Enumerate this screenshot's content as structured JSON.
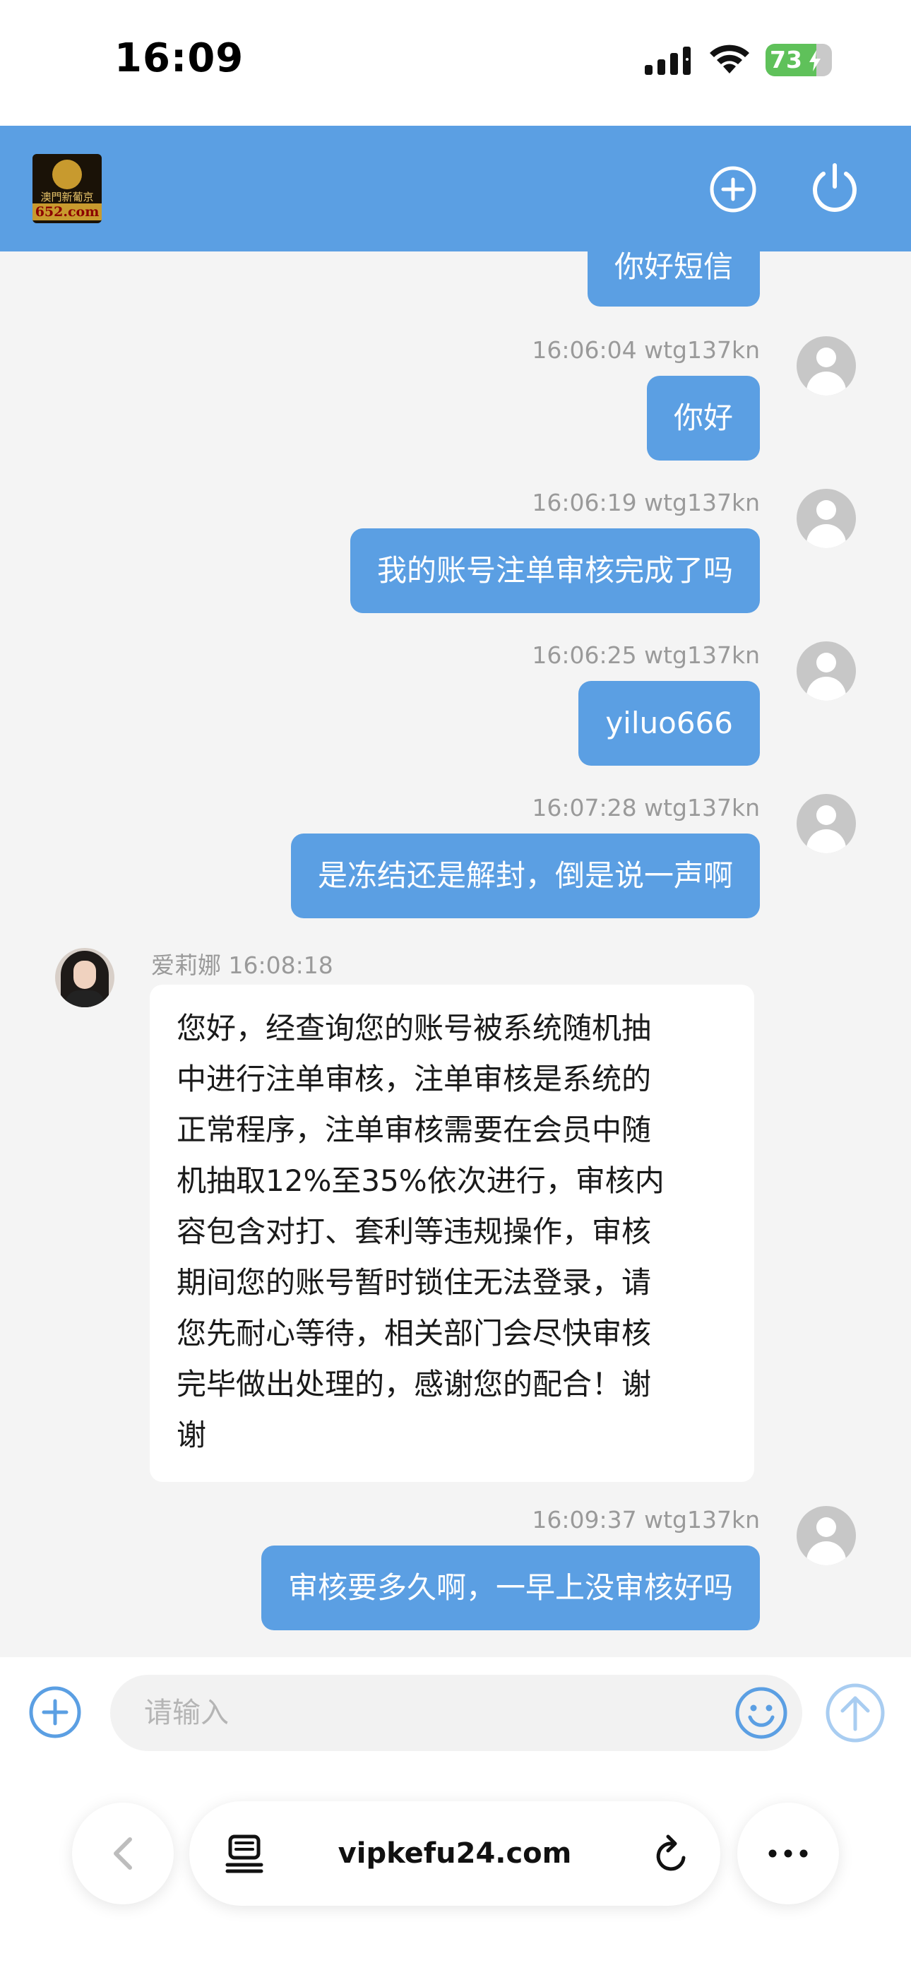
{
  "status_bar": {
    "time": "16:09",
    "battery": "73"
  },
  "header": {
    "logo_top_text": "澳門新葡京",
    "logo_bottom_text": "652.com"
  },
  "chat": {
    "partial_message": "你好短信",
    "messages": [
      {
        "time": "16:06:04",
        "user": "wtg137kn",
        "text": "你好"
      },
      {
        "time": "16:06:19",
        "user": "wtg137kn",
        "text": "我的账号注单审核完成了吗"
      },
      {
        "time": "16:06:25",
        "user": "wtg137kn",
        "text": "yiluo666"
      },
      {
        "time": "16:07:28",
        "user": "wtg137kn",
        "text": "是冻结还是解封，倒是说一声啊"
      }
    ],
    "agent": {
      "name": "爱莉娜",
      "time": "16:08:18",
      "lines": [
        "您好，经查询您的账号被系统随机抽",
        "中进行注单审核，注单审核是系统的",
        "正常程序，注单审核需要在会员中随",
        "机抽取12%至35%依次进行，审核内",
        "容包含对打、套利等违规操作，审核",
        "期间您的账号暂时锁住无法登录，请",
        "您先耐心等待，相关部门会尽快审核",
        "完毕做出处理的，感谢您的配合！谢",
        "谢"
      ]
    },
    "last_message": {
      "time": "16:09:37",
      "user": "wtg137kn",
      "text": "审核要多久啊，一早上没审核好吗"
    }
  },
  "composer": {
    "placeholder": "请输入"
  },
  "browser": {
    "url": "vipkefu24.com"
  },
  "colors": {
    "accent": "#5b9fe3",
    "chat_bg": "#f4f4f4",
    "battery": "#5fc15a"
  },
  "icons": {
    "header_add": "plus-circle-icon",
    "header_power": "power-icon",
    "composer_add": "plus-circle-icon",
    "emoji": "smiley-icon",
    "send": "arrow-up-circle-icon",
    "back": "chevron-left-icon",
    "tabs": "tabs-icon",
    "reload": "reload-icon",
    "more": "ellipsis-icon"
  }
}
